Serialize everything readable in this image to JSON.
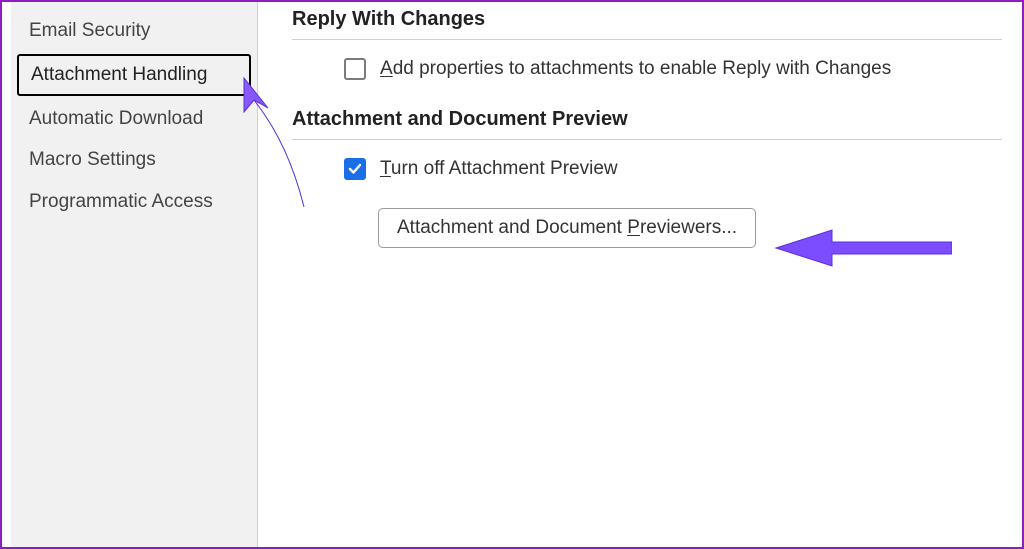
{
  "sidebar": {
    "items": [
      {
        "label": "Email Security"
      },
      {
        "label": "Attachment Handling"
      },
      {
        "label": "Automatic Download"
      },
      {
        "label": "Macro Settings"
      },
      {
        "label": "Programmatic Access"
      }
    ]
  },
  "sections": {
    "reply": {
      "title": "Reply With Changes",
      "addProps": {
        "checked": false,
        "accel": "A",
        "rest": "dd properties to attachments to enable Reply with Changes"
      }
    },
    "preview": {
      "title": "Attachment and Document Preview",
      "turnOff": {
        "checked": true,
        "accel": "T",
        "rest": "urn off Attachment Preview"
      },
      "button": {
        "before": "Attachment and Document ",
        "accel": "P",
        "after": "reviewers..."
      }
    }
  },
  "colors": {
    "accent": "#7c4dff",
    "check": "#1a6fe8",
    "frame": "#8c1cc9"
  }
}
